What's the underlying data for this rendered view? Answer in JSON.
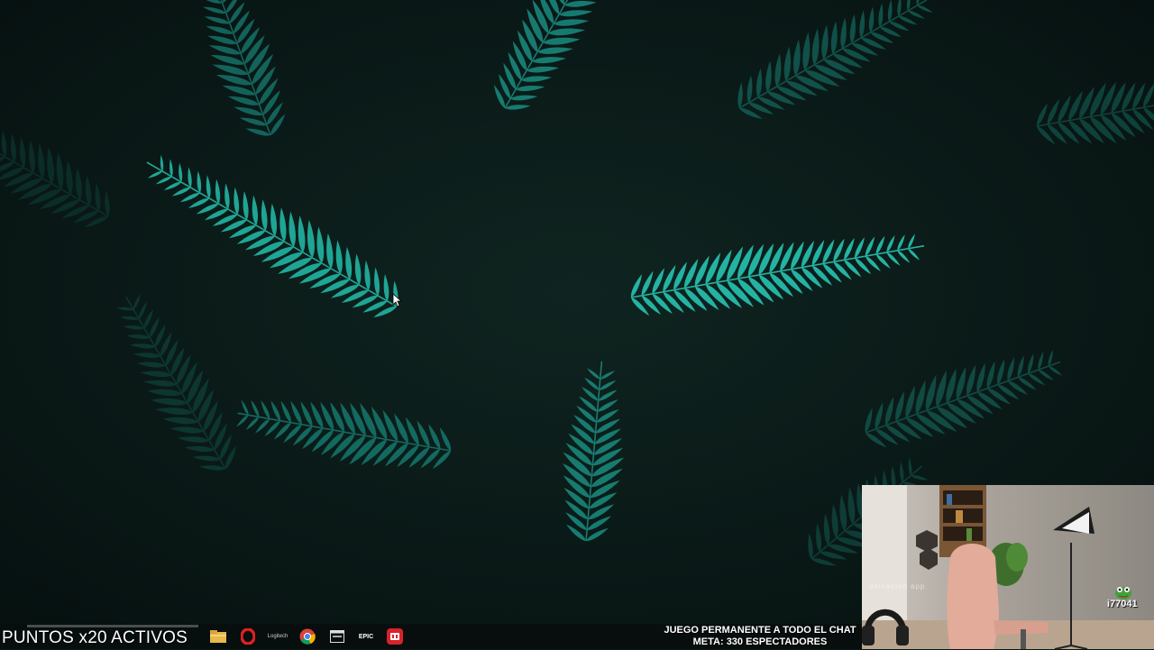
{
  "overlay": {
    "points_text": "PUNTOS x20 ACTIVOS",
    "chat_line1": "JUEGO PERMANENTE A TODO EL CHAT",
    "chat_line2": "META: 330 ESPECTADORES"
  },
  "webcam": {
    "watermark": "ubicacion app",
    "viewer_count": "i77041",
    "emote_icon": "frog-emote-icon"
  },
  "taskbar": {
    "icons": [
      "file-explorer-icon",
      "opera-browser-icon",
      "logitech-app-icon",
      "chrome-icon",
      "app-window-icon",
      "epic-games-icon",
      "streaming-app-icon"
    ],
    "logitech_label": "Logitech",
    "epic_label": "EPIC"
  },
  "colors": {
    "fern": "#1f9e92",
    "background": "#0a1816",
    "taskbar": "#080e0e"
  }
}
